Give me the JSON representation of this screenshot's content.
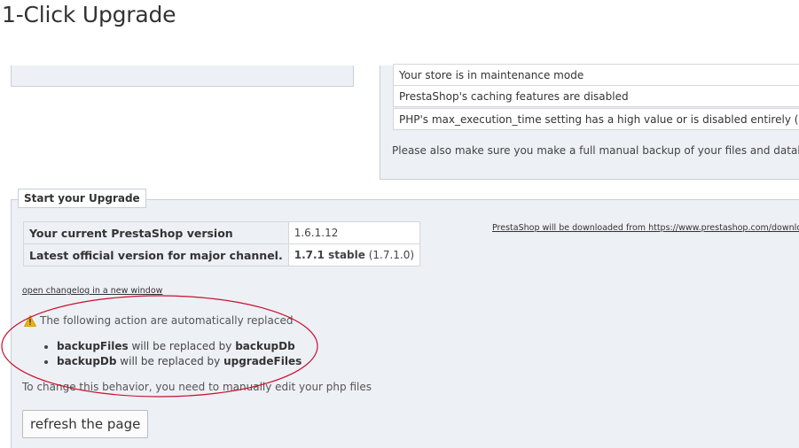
{
  "page": {
    "title": "1-Click Upgrade"
  },
  "checklist": {
    "items": [
      "Your store is in maintenance mode",
      "PrestaShop's caching features are disabled",
      "PHP's max_execution_time setting has a high value or is disabled entirely (current"
    ],
    "backup_note": "Please also make sure you make a full manual backup of your files and database."
  },
  "upgrade": {
    "legend": "Start your Upgrade",
    "current_label": "Your current PrestaShop version",
    "current_value": "1.6.1.12",
    "latest_label": "Latest official version for major channel.",
    "latest_value_bold": "1.7.1 stable",
    "latest_value_extra": "(1.7.1.0)",
    "download_link": "PrestaShop will be downloaded from https://www.prestashop.com/downloads",
    "changelog_link": "open changelog in a new window",
    "warning_text": "The following action are automatically replaced",
    "replacements": [
      {
        "from": "backupFiles",
        "middle": "will be replaced by",
        "to": "backupDb"
      },
      {
        "from": "backupDb",
        "middle": "will be replaced by",
        "to": "upgradeFiles"
      }
    ],
    "behavior_note": "To change this behavior, you need to manually edit your php files",
    "refresh_label": "refresh the page"
  },
  "colors": {
    "panel_bg": "#edf0f5",
    "annotation": "#c8102e",
    "warning": "#f0b400"
  },
  "icons": {
    "warning": "warning-icon"
  }
}
